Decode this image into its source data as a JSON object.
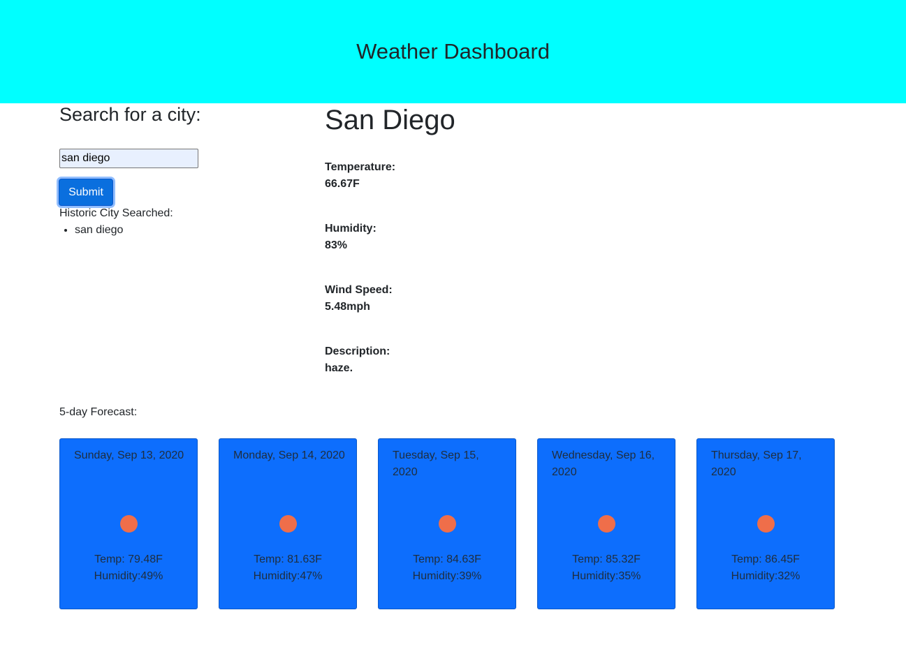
{
  "header": {
    "title": "Weather Dashboard",
    "background": "#00ffff"
  },
  "search": {
    "heading": "Search for a city:",
    "input_value": "san diego",
    "submit_label": "Submit",
    "history_label": "Historic City Searched:",
    "history": [
      "san diego"
    ]
  },
  "current": {
    "city": "San Diego",
    "temperature_label": "Temperature:",
    "temperature_value": "66.67F",
    "humidity_label": "Humidity:",
    "humidity_value": "83%",
    "wind_label": "Wind Speed:",
    "wind_value": "5.48mph",
    "description_label": "Description:",
    "description_value": "haze."
  },
  "forecast": {
    "label": "5-day Forecast:",
    "card_color": "#0d6efd",
    "icon_color": "#ef6e4a",
    "days": [
      {
        "date": "Sunday, Sep 13, 2020",
        "icon": "sun-icon",
        "temp": "Temp: 79.48F",
        "humidity": "Humidity:49%"
      },
      {
        "date": "Monday, Sep 14, 2020",
        "icon": "sun-icon",
        "temp": "Temp: 81.63F",
        "humidity": "Humidity:47%"
      },
      {
        "date": "Tuesday, Sep 15, 2020",
        "icon": "sun-icon",
        "temp": "Temp: 84.63F",
        "humidity": "Humidity:39%"
      },
      {
        "date": "Wednesday, Sep 16, 2020",
        "icon": "sun-icon",
        "temp": "Temp: 85.32F",
        "humidity": "Humidity:35%"
      },
      {
        "date": "Thursday, Sep 17, 2020",
        "icon": "sun-icon",
        "temp": "Temp: 86.45F",
        "humidity": "Humidity:32%"
      }
    ]
  }
}
